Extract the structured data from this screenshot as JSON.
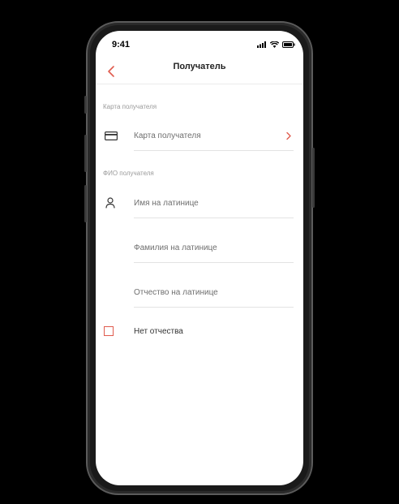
{
  "status": {
    "time": "9:41"
  },
  "header": {
    "title": "Получатель"
  },
  "card_section": {
    "label": "Карта получателя",
    "field_label": "Карта получателя"
  },
  "name_section": {
    "label": "ФИО получателя",
    "first_name_placeholder": "Имя на латинице",
    "last_name_placeholder": "Фамилия на латинице",
    "patronymic_placeholder": "Отчество на латинице"
  },
  "no_patronymic": {
    "label": "Нет отчества",
    "checked": false
  },
  "colors": {
    "accent": "#e05b4e"
  },
  "icons": {
    "back": "chevron-left-icon",
    "card": "card-icon",
    "person": "person-icon",
    "chevron": "chevron-right-icon"
  }
}
